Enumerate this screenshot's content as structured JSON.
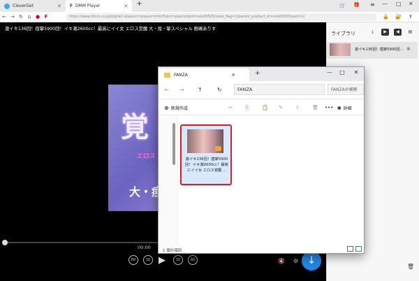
{
  "tabs": [
    {
      "label": "CleverGet"
    },
    {
      "label": "DMM Player"
    }
  ],
  "address": {
    "url": "https://www.dmm.co.jp/digital/-/player/=/player=html5/act=playlist/pid=ssis00505/view_flag=1/parent_product_id=ssis00505/part=1/"
  },
  "video": {
    "title": "激イキ136回！痙攣5900回！イキ潮2600cc！最高にイイ女 エロス覚醒 大・痙・攣スペシャル 飽嶋ありす",
    "cover_big": "覚",
    "cover_eros": "エロス",
    "cover_sub": "大・痙",
    "time": "00:00",
    "skip_back_60": "60",
    "skip_back_10": "10",
    "skip_fwd_10": "10",
    "skip_fwd_60": "60",
    "play": "▶",
    "download": "↓"
  },
  "library": {
    "title": "ライブラリ",
    "item": "激イキ136回！痙攣5900回…"
  },
  "explorer": {
    "tab": "FANZA",
    "addr": "FANZA",
    "search": "FANZAの検索",
    "new": "新規作成",
    "detail": "詳細",
    "file_name": "激イキ136回！痙攣5900回！イキ潮2600cc！最高にイイ女 エロス覚醒 ...",
    "status": "1 個の項目"
  },
  "icons": {
    "back": "back-icon",
    "forward": "forward-icon",
    "refresh": "refresh-icon",
    "home": "home-icon",
    "download": "download-icon"
  }
}
